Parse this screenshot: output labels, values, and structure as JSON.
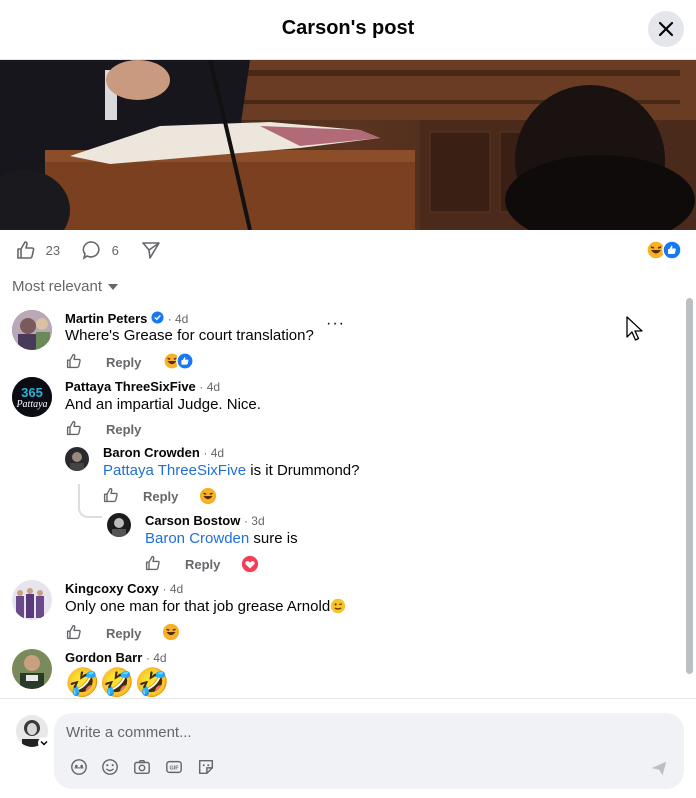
{
  "header": {
    "title": "Carson's post"
  },
  "post_actions": {
    "like_count": "23",
    "comment_count": "6"
  },
  "sort": {
    "label": "Most relevant"
  },
  "comments": [
    {
      "name": "Martin Peters",
      "time": "· 4d",
      "text": "Where's Grease for court translation?",
      "reply": "Reply",
      "more": "···"
    },
    {
      "name": "Pattaya ThreeSixFive",
      "time": "· 4d",
      "text": "And an impartial Judge. Nice.",
      "reply": "Reply",
      "avatar_text": "365"
    },
    {
      "name": "Baron Crowden",
      "time": "· 4d",
      "mention": "Pattaya ThreeSixFive",
      "text": " is it Drummond?",
      "reply": "Reply"
    },
    {
      "name": "Carson Bostow",
      "time": "· 3d",
      "mention": "Baron Crowden",
      "text": " sure is",
      "reply": "Reply"
    },
    {
      "name": "Kingcoxy Coxy",
      "time": "· 4d",
      "text": "Only one man for that job grease Arnold",
      "reply": "Reply"
    },
    {
      "name": "Gordon Barr",
      "time": "· 4d",
      "text": "🤣🤣🤣"
    }
  ],
  "composer": {
    "placeholder": "Write a comment..."
  },
  "colors": {
    "accent": "#216fdb",
    "like": "#1877f2",
    "love": "#f33e58",
    "haha": "#f7b125"
  }
}
